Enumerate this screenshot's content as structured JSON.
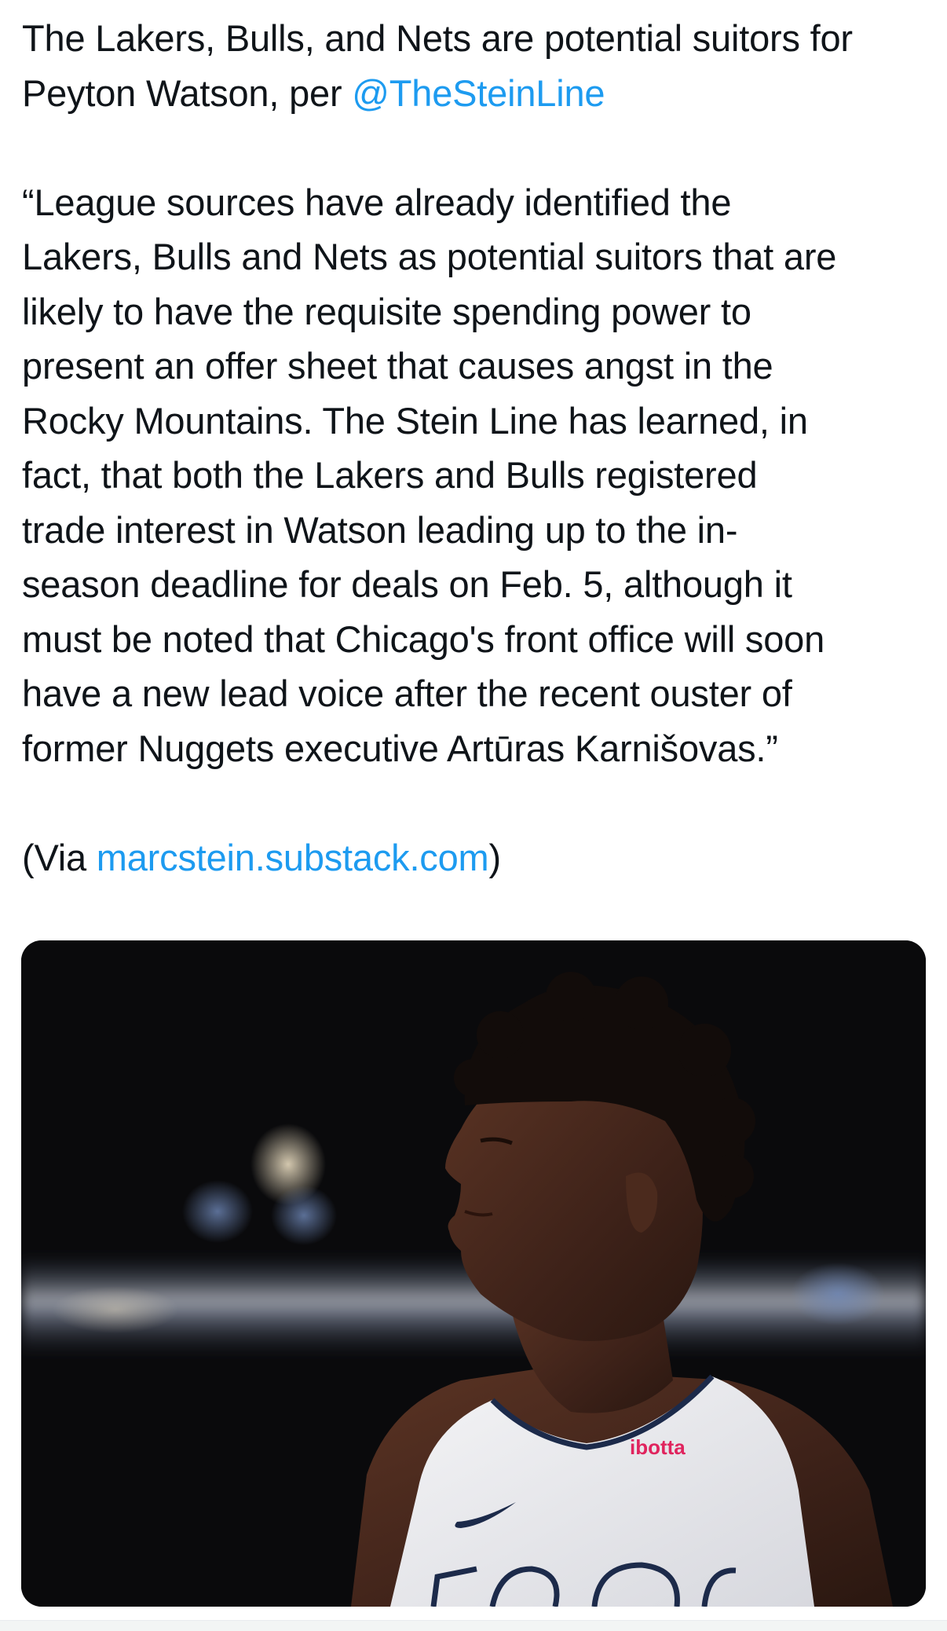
{
  "tweet": {
    "headline_text": "The Lakers, Bulls, and Nets are potential suitors for Peyton Watson, per ",
    "mention": "@TheSteinLine",
    "quote_lines": [
      "“League sources have already identified the",
      "Lakers, Bulls and Nets as potential suitors that are",
      "likely to have the requisite spending power to",
      "present an offer sheet that causes angst in the",
      "Rocky Mountains. The Stein Line has learned, in",
      "fact, that both the Lakers and Bulls registered",
      "trade interest in Watson leading up to the in-",
      "season deadline for deals on Feb. 5, although it",
      "must be noted that Chicago's front office will soon",
      "have a new lead voice after the recent ouster of",
      "former Nuggets executive Artūras Karnišovas.”"
    ],
    "via_prefix": "(Via ",
    "via_link": "marcstein.substack.com",
    "via_suffix": ")"
  },
  "media": {
    "jersey_sponsor": "ibotta"
  },
  "colors": {
    "text": "#0f1419",
    "link": "#1d9bf0",
    "background": "#ffffff"
  }
}
